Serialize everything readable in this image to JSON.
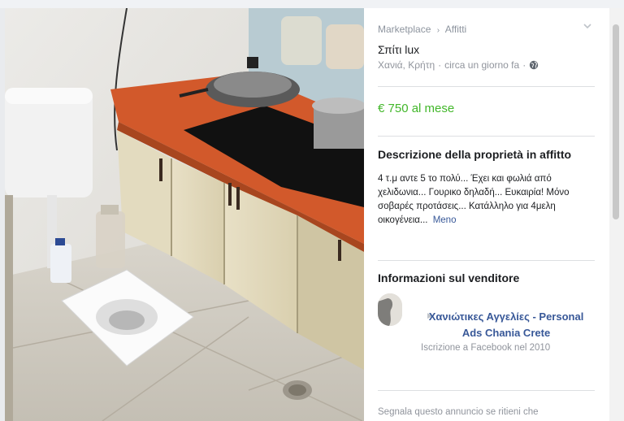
{
  "breadcrumb": {
    "root": "Marketplace",
    "separator": "›",
    "current": "Affitti"
  },
  "listing": {
    "title": "Σπίτι lux",
    "location": "Χανιά, Κρήτη",
    "posted": "circa un giorno fa",
    "location_separator": "·",
    "privacy_icon": "globe-icon",
    "price": "€ 750 al mese",
    "price_color": "#42b72a"
  },
  "description": {
    "heading": "Descrizione della proprietà in affitto",
    "text": "4 τ.μ αντε 5 το πολύ... Έχει και φωλιά από χελιδωνια... Γουρικο δηλαδή... Ευκαιρία! Μόνο σοβαρές προτάσεις... Κατάλληλο για 4μελη οικογένεια...",
    "more": "Meno"
  },
  "seller": {
    "heading": "Informazioni sul venditore",
    "name": "Χανιώτικες Αγγελίες - Personal Ads Chania Crete",
    "joined": "Iscrizione a Facebook nel 2010",
    "link_color": "#385898"
  },
  "footer": {
    "report": "Segnala questo annuncio se ritieni che"
  }
}
